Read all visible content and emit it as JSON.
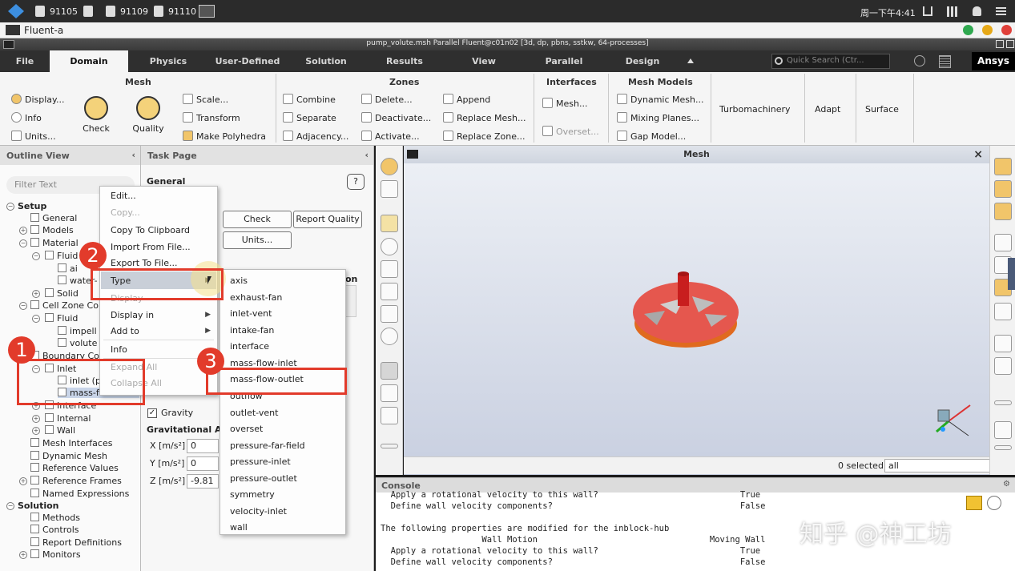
{
  "os_bar": {
    "tasks": [
      "91105",
      "91109",
      "91110"
    ],
    "clock": "周一下午4:41"
  },
  "app": {
    "title": "Fluent-a"
  },
  "fluent_title": "pump_volute.msh Parallel Fluent@c01n02  [3d, dp, pbns, sstkw, 64-processes]",
  "tabs": [
    "File",
    "Domain",
    "Physics",
    "User-Defined",
    "Solution",
    "Results",
    "View",
    "Parallel",
    "Design"
  ],
  "search_placeholder": "Quick Search (Ctr...",
  "brand": "Ansys",
  "ribbon": {
    "mesh": {
      "title": "Mesh",
      "display": "Display...",
      "info": "Info",
      "units": "Units...",
      "check": "Check",
      "quality": "Quality",
      "scale": "Scale...",
      "transform": "Transform",
      "make_polyhedra": "Make Polyhedra"
    },
    "zones": {
      "title": "Zones",
      "combine": "Combine",
      "separate": "Separate",
      "adjacency": "Adjacency...",
      "delete": "Delete...",
      "deactivate": "Deactivate...",
      "activate": "Activate...",
      "append": "Append",
      "replace_mesh": "Replace Mesh...",
      "replace_zone": "Replace Zone..."
    },
    "interfaces": {
      "title": "Interfaces",
      "mesh": "Mesh...",
      "overset": "Overset..."
    },
    "mesh_models": {
      "title": "Mesh Models",
      "dynamic_mesh": "Dynamic Mesh...",
      "mixing_planes": "Mixing Planes...",
      "gap_model": "Gap Model..."
    },
    "turbomachinery": "Turbomachinery",
    "adapt": "Adapt",
    "surface": "Surface"
  },
  "outline": {
    "title": "Outline View",
    "filter_placeholder": "Filter Text",
    "items": {
      "setup": "Setup",
      "general": "General",
      "models": "Models",
      "materials": "Material",
      "fluid_mat": "Fluid",
      "air": "ai",
      "water": "water-",
      "solid": "Solid",
      "cell_zone": "Cell Zone Co",
      "fluid_zone": "Fluid",
      "impeller": "impell",
      "volute": "volute",
      "boundary": "Boundary Co",
      "inlet": "Inlet",
      "inlet_p": "inlet (p",
      "mass_flow_inlet": "mass-flow-inlet",
      "interface": "Interface",
      "internal": "Internal",
      "wall": "Wall",
      "mesh_interfaces": "Mesh Interfaces",
      "dynamic_mesh": "Dynamic Mesh",
      "reference_values": "Reference Values",
      "reference_frames": "Reference Frames",
      "named_expressions": "Named Expressions",
      "solution": "Solution",
      "methods": "Methods",
      "controls": "Controls",
      "report_definitions": "Report Definitions",
      "monitors": "Monitors"
    }
  },
  "task_page": {
    "title": "Task Page",
    "general": "General",
    "check": "Check",
    "report_quality": "Report Quality",
    "units": "Units...",
    "on_label": "on",
    "gravity": "Gravity",
    "grav_accel": "Gravitational A",
    "x_label": "X [m/s²]",
    "x_val": "0",
    "y_label": "Y [m/s²]",
    "y_val": "0",
    "z_label": "Z [m/s²]",
    "z_val": "-9.81"
  },
  "context_menu": {
    "edit": "Edit...",
    "copy": "Copy...",
    "copy_clipboard": "Copy To Clipboard",
    "import": "Import From File...",
    "export": "Export To File...",
    "type": "Type",
    "display": "Display",
    "display_in": "Display in",
    "add_to": "Add to",
    "info": "Info",
    "expand_all": "Expand All",
    "collapse_all": "Collapse All"
  },
  "type_submenu": [
    "axis",
    "exhaust-fan",
    "inlet-vent",
    "intake-fan",
    "interface",
    "mass-flow-inlet",
    "mass-flow-outlet",
    "outflow",
    "outlet-vent",
    "overset",
    "pressure-far-field",
    "pressure-inlet",
    "pressure-outlet",
    "symmetry",
    "velocity-inlet",
    "wall"
  ],
  "viewport": {
    "title": "Mesh",
    "selected": "0 selected",
    "filter": "all"
  },
  "console": {
    "title": "Console",
    "lines": [
      "  Apply a rotational velocity to this wall?                            True",
      "  Define wall velocity components?                                     False",
      "",
      "The following properties are modified for the inblock-hub",
      "                    Wall Motion                                  Moving Wall",
      "  Apply a rotational velocity to this wall?                            True",
      "  Define wall velocity components?                                     False"
    ]
  },
  "badges": [
    "1",
    "2",
    "3"
  ],
  "watermark": "知乎 @神工坊",
  "colors": {
    "annotation": "#e23b2b",
    "tab_bar": "#2f2f2f",
    "model": "#e5574e"
  }
}
